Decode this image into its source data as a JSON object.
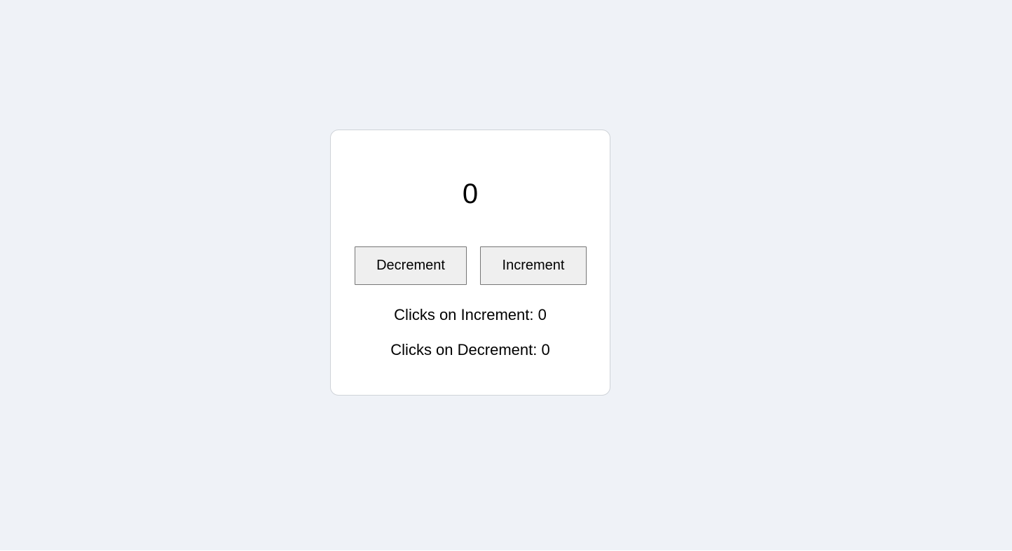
{
  "counter": {
    "value": "0"
  },
  "buttons": {
    "decrement_label": "Decrement",
    "increment_label": "Increment"
  },
  "stats": {
    "increment_clicks": "Clicks on Increment: 0",
    "decrement_clicks": "Clicks on Decrement: 0"
  },
  "colors": {
    "page_background": "#eff2f7",
    "card_background": "#ffffff",
    "button_background": "#efefef"
  }
}
